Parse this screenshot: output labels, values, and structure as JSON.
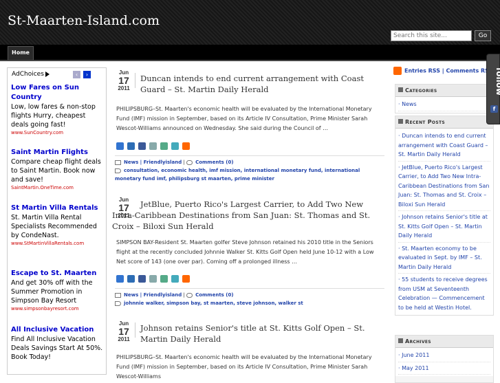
{
  "site": {
    "title": "St-Maarten-Island.com"
  },
  "search": {
    "placeholder": "Search this site...",
    "go_label": "Go"
  },
  "nav": {
    "home": "Home"
  },
  "ads": {
    "adchoices": "AdChoices",
    "items": [
      {
        "title": "Low Fares on Sun Country",
        "text": "Low, low fares & non-stop flights Hurry, cheapest deals going fast!",
        "url": "www.SunCountry.com"
      },
      {
        "title": "Saint Martin Flights",
        "text": "Compare cheap flight deals to Saint Martin. Book now and save!",
        "url": "SaintMartin.OneTime.com"
      },
      {
        "title": "St Martin Villa Rentals",
        "text": "St. Martin Villa Rental Specialists Recommended by CondeNast.",
        "url": "www.StMartinVillaRentals.com"
      },
      {
        "title": "Escape to St. Maarten",
        "text": "And get 30% off with the Summer Promotion in Simpson Bay Resort",
        "url": "www.simpsonbayresort.com"
      },
      {
        "title": "All Inclusive Vacation",
        "text": "Find All Inclusive Vacation Deals Savings Start At 50%. Book Today!",
        "url": ""
      }
    ]
  },
  "posts": [
    {
      "mon": "Jun",
      "day": "17",
      "yr": "2011",
      "title": "Duncan intends to end current arrangement with Coast Guard – St. Martin Daily Herald",
      "excerpt": "PHILIPSBURG–St. Maarten's economic health will be evaluated by the International Monetary Fund (IMF) mission in September, based on its Article IV Consultation, Prime Minister Sarah Wescot-Williams announced on Wednesday. She said during the Council of …",
      "cats": "News | Friendlyisland",
      "comments": "Comments (0)",
      "tags": "consultation, economic health, imf mission, international monetary fund, international monetary fund imf, philipsburg st maarten, prime minister"
    },
    {
      "mon": "Jun",
      "day": "17",
      "yr": "2011",
      "title": "JetBlue, Puerto Rico's Largest Carrier, to Add Two New Intra-Caribbean Destinations from San Juan: St. Thomas and St. Croix – Biloxi Sun Herald",
      "excerpt": "SIMPSON BAY-Resident St. Maarten golfer Steve Johnson retained his 2010 title in the Seniors flight at the recently concluded Johnnie Walker St. Kitts Golf Open held June 10-12 with a Low Net score of 143 (one over par). Coming off a prolonged illness …",
      "cats": "News | Friendlyisland",
      "comments": "Comments (0)",
      "tags": "johnnie walker, simpson bay, st maarten, steve johnson, walker st"
    },
    {
      "mon": "Jun",
      "day": "17",
      "yr": "2011",
      "title": "Johnson retains Senior's title at St. Kitts Golf Open – St. Martin Daily Herald",
      "excerpt": "PHILIPSBURG–St. Maarten's economic health will be evaluated by the International Monetary Fund (IMF) mission in September, based on its Article IV Consultation, Prime Minister Sarah Wescot-Williams",
      "cats": "",
      "comments": "",
      "tags": ""
    }
  ],
  "rss": {
    "entries": "Entries RSS",
    "sep": "|",
    "comments": "Comments RSS"
  },
  "sidebar": {
    "categories": {
      "title": "Categories",
      "items": [
        "News"
      ]
    },
    "recent": {
      "title": "Recent Posts",
      "items": [
        "Duncan intends to end current arrangement with Coast Guard – St. Martin Daily Herald",
        "JetBlue, Puerto Rico's Largest Carrier, to Add Two New Intra-Caribbean Destinations from San Juan: St. Thomas and St. Croix – Biloxi Sun Herald",
        "Johnson retains Senior's title at St. Kitts Golf Open – St. Martin Daily Herald",
        "St. Maarten economy to be evaluated in Sept. by IMF – St. Martin Daily Herald",
        "55 students to receive degrees from USM at Seventeenth Celebration — Commencement to be held at Westin Hotel."
      ]
    },
    "archives": {
      "title": "Archives",
      "items": [
        "June 2011",
        "May 2011"
      ]
    }
  },
  "follow": {
    "label": "follow",
    "fb": "f"
  }
}
